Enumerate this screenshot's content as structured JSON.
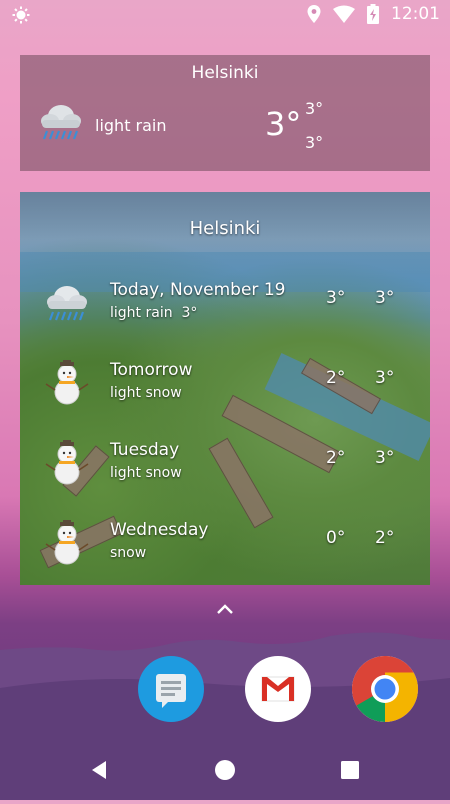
{
  "status_bar": {
    "time": "12:01",
    "icons": [
      "brightness-icon",
      "location-icon",
      "wifi-icon",
      "battery-charging-icon"
    ]
  },
  "widget_small": {
    "city": "Helsinki",
    "condition": "light rain",
    "temperature": "3°",
    "high": "3°",
    "low": "3°",
    "icon": "rain-cloud-icon"
  },
  "widget_forecast": {
    "city": "Helsinki",
    "days": [
      {
        "day": "Today, November 19",
        "condition": "light rain",
        "inline_temp": "3°",
        "temp_a": "3°",
        "temp_b": "3°",
        "icon": "rain-cloud-icon"
      },
      {
        "day": "Tomorrow",
        "condition": "light snow",
        "temp_a": "2°",
        "temp_b": "3°",
        "icon": "snowman-icon"
      },
      {
        "day": "Tuesday",
        "condition": "light snow",
        "temp_a": "2°",
        "temp_b": "3°",
        "icon": "snowman-icon"
      },
      {
        "day": "Wednesday",
        "condition": "snow",
        "temp_a": "0°",
        "temp_b": "2°",
        "icon": "snowman-icon"
      }
    ]
  },
  "dock": {
    "apps": [
      "Messages",
      "Gmail",
      "Chrome"
    ]
  },
  "nav_bar": {
    "buttons": [
      "back-button",
      "home-button",
      "recents-button"
    ]
  },
  "colors": {
    "messages_blue": "#1e9be0",
    "gmail_red": "#d93025",
    "chrome_red": "#db4437",
    "chrome_green": "#0f9d58",
    "chrome_yellow": "#f4b400",
    "chrome_blue": "#4285f4"
  }
}
